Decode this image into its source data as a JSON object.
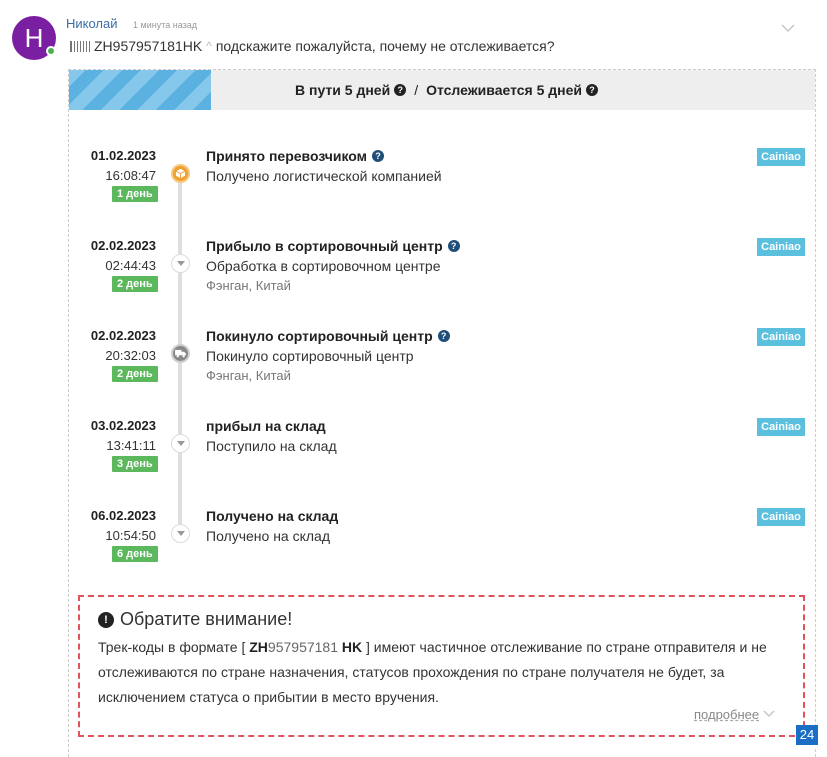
{
  "comment": {
    "avatar_letter": "Н",
    "author": "Николай",
    "time": "1 минута назад",
    "track_code": "ZH957957181HK",
    "text": "подскажите пожалуйста, почему не отслеживается?"
  },
  "tracking": {
    "progress_fraction": 0.19,
    "status_in_transit": "В пути 5 дней",
    "separator": "/",
    "status_tracked": "Отслеживается 5 дней",
    "events": [
      {
        "date": "01.02.2023",
        "time": "16:08:47",
        "days": "1 день",
        "title": "Принято перевозчиком",
        "has_help": true,
        "desc": "Получено логистической компанией",
        "location": "",
        "carrier": "Cainiao",
        "icon": "box-icon"
      },
      {
        "date": "02.02.2023",
        "time": "02:44:43",
        "days": "2 день",
        "title": "Прибыло в сортировочный центр",
        "has_help": true,
        "desc": "Обработка в сортировочном центре",
        "location": "Фэнган, Китай",
        "carrier": "Cainiao",
        "icon": "chevron-down-icon"
      },
      {
        "date": "02.02.2023",
        "time": "20:32:03",
        "days": "2 день",
        "title": "Покинуло сортировочный центр",
        "has_help": true,
        "desc": "Покинуло сортировочный центр",
        "location": "Фэнган, Китай",
        "carrier": "Cainiao",
        "icon": "truck-icon"
      },
      {
        "date": "03.02.2023",
        "time": "13:41:11",
        "days": "3 день",
        "title": "прибыл на склад",
        "has_help": false,
        "desc": "Поступило на склад",
        "location": "",
        "carrier": "Cainiao",
        "icon": "chevron-down-icon"
      },
      {
        "date": "06.02.2023",
        "time": "10:54:50",
        "days": "6 день",
        "title": "Получено на склад",
        "has_help": false,
        "desc": "Получено на склад",
        "location": "",
        "carrier": "Cainiao",
        "icon": "chevron-down-icon"
      }
    ]
  },
  "notice": {
    "title": "Обратите внимание!",
    "text_before": "Трек-коды в формате [",
    "code_prefix": "ZH",
    "code_digits": "957957181",
    "code_suffix": "HK",
    "text_after": "] имеют частичное отслеживание по стране отправителя и не отслеживаются по стране назначения, статусов прохождения по стране получателя не будет, за исключением статуса о прибытии в место вручения.",
    "more_label": "подробнее"
  },
  "page_number": "24",
  "colors": {
    "accent": "#5bc0de",
    "days_badge": "#5cb85c",
    "notice_border": "#e0535a",
    "avatar": "#7b1fa2"
  }
}
